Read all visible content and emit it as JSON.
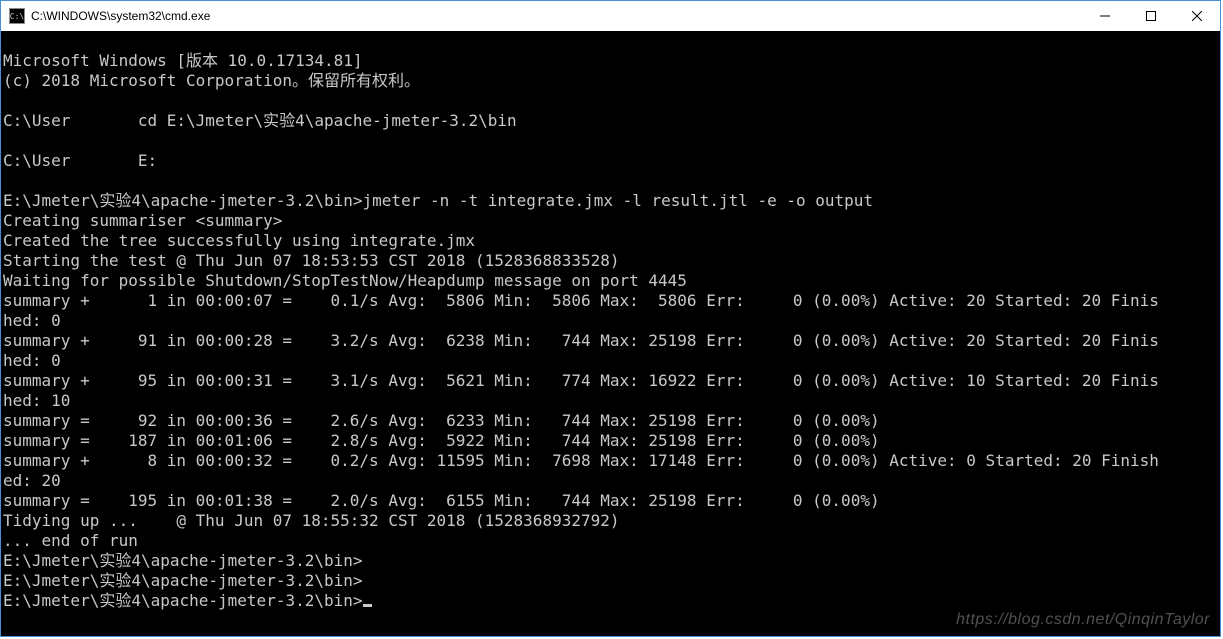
{
  "window": {
    "title": "C:\\WINDOWS\\system32\\cmd.exe",
    "icon_label": "cmd-icon"
  },
  "terminal": {
    "banner1": "Microsoft Windows [版本 10.0.17134.81]",
    "banner2": "(c) 2018 Microsoft Corporation。保留所有权利。",
    "blank": "",
    "p1_a": "C:\\User",
    "p1_b": "cd E:\\Jmeter\\实验4\\apache-jmeter-3.2\\bin",
    "p2_a": "C:\\User",
    "p2_b": "E:",
    "cmd_prompt": "E:\\Jmeter\\实验4\\apache-jmeter-3.2\\bin>",
    "cmd_line": "jmeter -n -t integrate.jmx -l result.jtl -e -o output",
    "l1": "Creating summariser <summary>",
    "l2": "Created the tree successfully using integrate.jmx",
    "l3": "Starting the test @ Thu Jun 07 18:53:53 CST 2018 (1528368833528)",
    "l4": "Waiting for possible Shutdown/StopTestNow/Heapdump message on port 4445",
    "s1": "summary +      1 in 00:00:07 =    0.1/s Avg:  5806 Min:  5806 Max:  5806 Err:     0 (0.00%) Active: 20 Started: 20 Finis",
    "s1b": "hed: 0",
    "s2": "summary +     91 in 00:00:28 =    3.2/s Avg:  6238 Min:   744 Max: 25198 Err:     0 (0.00%) Active: 20 Started: 20 Finis",
    "s2b": "hed: 0",
    "s3": "summary +     95 in 00:00:31 =    3.1/s Avg:  5621 Min:   774 Max: 16922 Err:     0 (0.00%) Active: 10 Started: 20 Finis",
    "s3b": "hed: 10",
    "s4": "summary =     92 in 00:00:36 =    2.6/s Avg:  6233 Min:   744 Max: 25198 Err:     0 (0.00%)",
    "s5": "summary =    187 in 00:01:06 =    2.8/s Avg:  5922 Min:   744 Max: 25198 Err:     0 (0.00%)",
    "s6": "summary +      8 in 00:00:32 =    0.2/s Avg: 11595 Min:  7698 Max: 17148 Err:     0 (0.00%) Active: 0 Started: 20 Finish",
    "s6b": "ed: 20",
    "s7": "summary =    195 in 00:01:38 =    2.0/s Avg:  6155 Min:   744 Max: 25198 Err:     0 (0.00%)",
    "tidy": "Tidying up ...    @ Thu Jun 07 18:55:32 CST 2018 (1528368932792)",
    "end": "... end of run",
    "pend1": "E:\\Jmeter\\实验4\\apache-jmeter-3.2\\bin>",
    "pend2": "E:\\Jmeter\\实验4\\apache-jmeter-3.2\\bin>",
    "pend3": "E:\\Jmeter\\实验4\\apache-jmeter-3.2\\bin>"
  },
  "watermark": "https://blog.csdn.net/QinqinTaylor"
}
